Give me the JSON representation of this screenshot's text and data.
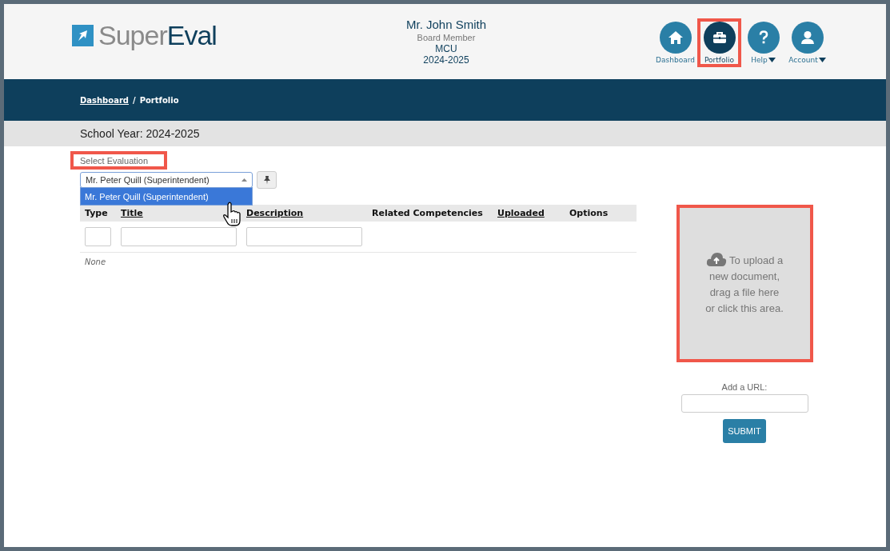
{
  "header": {
    "logo": {
      "text_main": "Super",
      "text_accent": "Eval"
    },
    "user": {
      "name": "Mr. John Smith",
      "role": "Board Member",
      "organization": "MCU",
      "year": "2024-2025"
    },
    "nav": [
      {
        "kind": "home",
        "label": "Dashboard",
        "selected": false,
        "has_menu": false,
        "annotated": false
      },
      {
        "kind": "briefcase",
        "label": "Portfolio",
        "selected": true,
        "has_menu": false,
        "annotated": true
      },
      {
        "kind": "help",
        "label": "Help",
        "selected": false,
        "has_menu": true,
        "annotated": false
      },
      {
        "kind": "account",
        "label": "Account",
        "selected": false,
        "has_menu": true,
        "annotated": false
      }
    ]
  },
  "breadcrumb": [
    {
      "label": "Dashboard",
      "link": true
    },
    {
      "label": "Portfolio",
      "link": false
    }
  ],
  "breadcrumb_separator": "/",
  "school_year": "School Year: 2024-2025",
  "evaluation_select": {
    "label": "Select Evaluation",
    "label_annotated": true,
    "value": "Mr. Peter Quill (Superintendent)",
    "expanded": true,
    "options": [
      {
        "label": "Mr. Peter Quill (Superintendent)",
        "selected": true
      }
    ]
  },
  "table": {
    "columns": [
      {
        "label": "Type",
        "sortable": false
      },
      {
        "label": "Title",
        "sortable": true
      },
      {
        "label": "Description",
        "sortable": true
      },
      {
        "label": "Related Competencies",
        "sortable": false
      },
      {
        "label": "Uploaded",
        "sortable": true
      },
      {
        "label": "Options",
        "sortable": false
      }
    ],
    "filter_fields": [
      {
        "kind": "small"
      },
      {
        "kind": "wide"
      },
      {
        "kind": "wide"
      }
    ],
    "empty_text": "None"
  },
  "upload": {
    "text": "To upload a new document, drag a file here or click this area.",
    "annotated": true
  },
  "url_field": {
    "label": "Add a URL:"
  },
  "submit_button": "SUBMIT"
}
